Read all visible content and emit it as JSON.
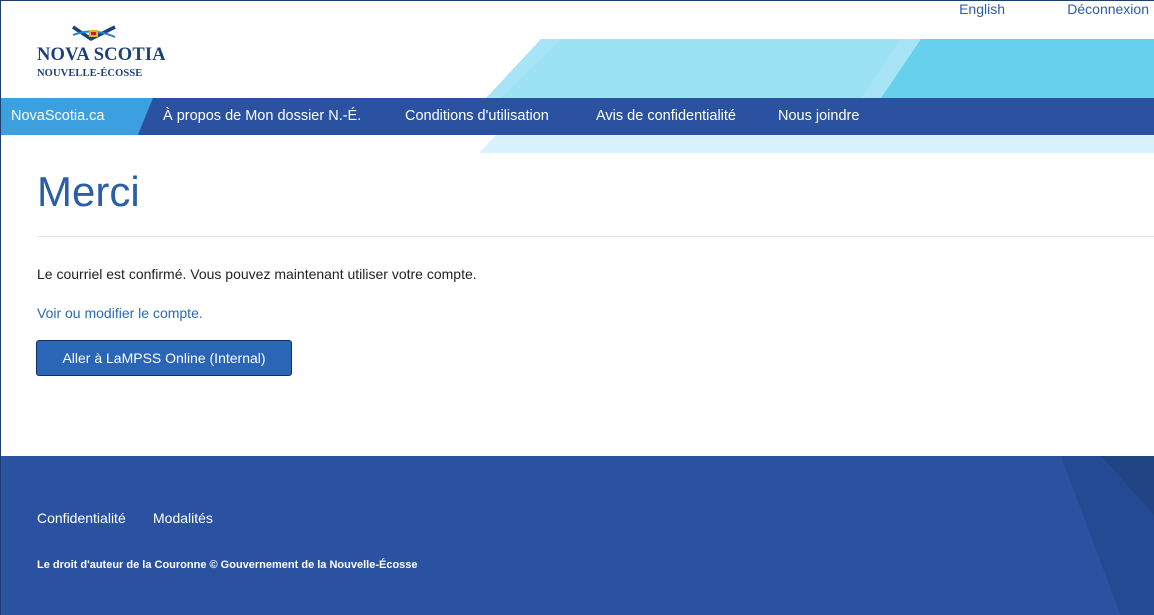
{
  "logo": {
    "line1": "NOVA SCOTIA",
    "line2": "NOUVELLE-ÉCOSSE"
  },
  "utility": {
    "language_link": "English",
    "logout_link": "Déconnexion"
  },
  "nav": {
    "home": "NovaScotia.ca",
    "items": [
      "À propos de Mon dossier N.-É.",
      "Conditions d'utilisation",
      "Avis de confidentialité",
      "Nous joindre"
    ]
  },
  "main": {
    "title": "Merci",
    "confirmation": "Le courriel est confirmé. Vous pouvez maintenant utiliser votre compte.",
    "account_link": "Voir ou modifier le compte.",
    "button_label": "Aller à LaMPSS Online (Internal)"
  },
  "footer": {
    "links": [
      "Confidentialité",
      "Modalités"
    ],
    "copyright": "Le droit d'auteur de la Couronne © Gouvernement de la Nouvelle-Écosse"
  },
  "colors": {
    "nav_blue": "#2a52a0",
    "home_blue": "#3b9fe0",
    "accent_cyan": "#5fd0ee",
    "link_blue": "#2a6ab3",
    "title_blue": "#2a5ea8"
  }
}
